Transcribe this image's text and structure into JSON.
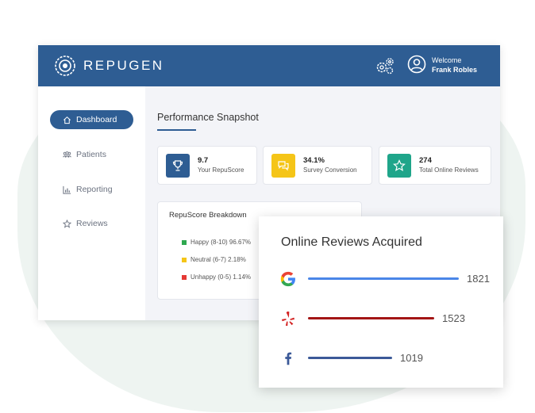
{
  "header": {
    "logo_text": "REPUGEN",
    "welcome_line1": "Welcome",
    "welcome_line2": "Frank Robles",
    "icons": [
      "settings-gear-icon",
      "user-circle-icon"
    ],
    "bg_color": "#2e5d93"
  },
  "sidebar": {
    "items": [
      {
        "label": "Dashboard",
        "icon": "home-icon",
        "active": true
      },
      {
        "label": "Patients",
        "icon": "users-icon",
        "active": false
      },
      {
        "label": "Reporting",
        "icon": "bar-chart-icon",
        "active": false
      },
      {
        "label": "Reviews",
        "icon": "star-icon",
        "active": false
      }
    ]
  },
  "main": {
    "title": "Performance Snapshot",
    "cards": [
      {
        "value": "9.7",
        "label": "Your RepuScore",
        "icon": "trophy-icon",
        "color": "#2e5d93"
      },
      {
        "value": "34.1%",
        "label": "Survey Conversion",
        "icon": "chat-bubbles-icon",
        "color": "#f5c518"
      },
      {
        "value": "274",
        "label": "Total Online Reviews",
        "icon": "star-icon",
        "color": "#1fa58a"
      }
    ],
    "breakdown": {
      "title": "RepuScore Breakdown",
      "items": [
        {
          "label": "Happy (8-10) 96.67%",
          "color": "#2fa84f"
        },
        {
          "label": "Neutral (6-7) 2.18%",
          "color": "#f5c518"
        },
        {
          "label": "Unhappy (0-5) 1.14%",
          "color": "#e53935"
        }
      ]
    }
  },
  "reviews": {
    "title": "Online Reviews Acquired",
    "sources": [
      {
        "source": "google",
        "icon": "google-icon",
        "count": "1821",
        "value": 1821,
        "color": "#4a86e8"
      },
      {
        "source": "yelp",
        "icon": "yelp-icon",
        "count": "1523",
        "value": 1523,
        "color": "#a31515"
      },
      {
        "source": "facebook",
        "icon": "facebook-icon",
        "count": "1019",
        "value": 1019,
        "color": "#3b5998"
      }
    ]
  }
}
